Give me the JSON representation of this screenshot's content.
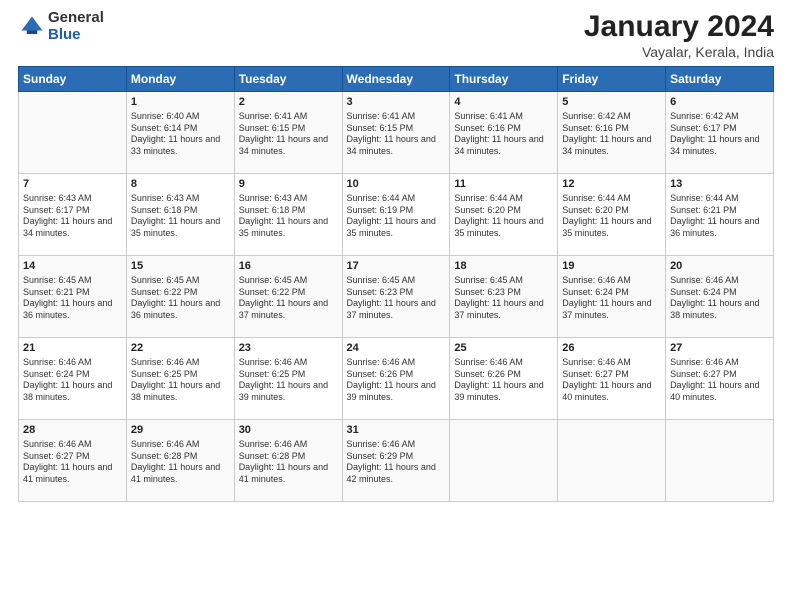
{
  "logo": {
    "general": "General",
    "blue": "Blue"
  },
  "header": {
    "title": "January 2024",
    "subtitle": "Vayalar, Kerala, India"
  },
  "columns": [
    "Sunday",
    "Monday",
    "Tuesday",
    "Wednesday",
    "Thursday",
    "Friday",
    "Saturday"
  ],
  "weeks": [
    [
      {
        "day": "",
        "sunrise": "",
        "sunset": "",
        "daylight": ""
      },
      {
        "day": "1",
        "sunrise": "Sunrise: 6:40 AM",
        "sunset": "Sunset: 6:14 PM",
        "daylight": "Daylight: 11 hours and 33 minutes."
      },
      {
        "day": "2",
        "sunrise": "Sunrise: 6:41 AM",
        "sunset": "Sunset: 6:15 PM",
        "daylight": "Daylight: 11 hours and 34 minutes."
      },
      {
        "day": "3",
        "sunrise": "Sunrise: 6:41 AM",
        "sunset": "Sunset: 6:15 PM",
        "daylight": "Daylight: 11 hours and 34 minutes."
      },
      {
        "day": "4",
        "sunrise": "Sunrise: 6:41 AM",
        "sunset": "Sunset: 6:16 PM",
        "daylight": "Daylight: 11 hours and 34 minutes."
      },
      {
        "day": "5",
        "sunrise": "Sunrise: 6:42 AM",
        "sunset": "Sunset: 6:16 PM",
        "daylight": "Daylight: 11 hours and 34 minutes."
      },
      {
        "day": "6",
        "sunrise": "Sunrise: 6:42 AM",
        "sunset": "Sunset: 6:17 PM",
        "daylight": "Daylight: 11 hours and 34 minutes."
      }
    ],
    [
      {
        "day": "7",
        "sunrise": "Sunrise: 6:43 AM",
        "sunset": "Sunset: 6:17 PM",
        "daylight": "Daylight: 11 hours and 34 minutes."
      },
      {
        "day": "8",
        "sunrise": "Sunrise: 6:43 AM",
        "sunset": "Sunset: 6:18 PM",
        "daylight": "Daylight: 11 hours and 35 minutes."
      },
      {
        "day": "9",
        "sunrise": "Sunrise: 6:43 AM",
        "sunset": "Sunset: 6:18 PM",
        "daylight": "Daylight: 11 hours and 35 minutes."
      },
      {
        "day": "10",
        "sunrise": "Sunrise: 6:44 AM",
        "sunset": "Sunset: 6:19 PM",
        "daylight": "Daylight: 11 hours and 35 minutes."
      },
      {
        "day": "11",
        "sunrise": "Sunrise: 6:44 AM",
        "sunset": "Sunset: 6:20 PM",
        "daylight": "Daylight: 11 hours and 35 minutes."
      },
      {
        "day": "12",
        "sunrise": "Sunrise: 6:44 AM",
        "sunset": "Sunset: 6:20 PM",
        "daylight": "Daylight: 11 hours and 35 minutes."
      },
      {
        "day": "13",
        "sunrise": "Sunrise: 6:44 AM",
        "sunset": "Sunset: 6:21 PM",
        "daylight": "Daylight: 11 hours and 36 minutes."
      }
    ],
    [
      {
        "day": "14",
        "sunrise": "Sunrise: 6:45 AM",
        "sunset": "Sunset: 6:21 PM",
        "daylight": "Daylight: 11 hours and 36 minutes."
      },
      {
        "day": "15",
        "sunrise": "Sunrise: 6:45 AM",
        "sunset": "Sunset: 6:22 PM",
        "daylight": "Daylight: 11 hours and 36 minutes."
      },
      {
        "day": "16",
        "sunrise": "Sunrise: 6:45 AM",
        "sunset": "Sunset: 6:22 PM",
        "daylight": "Daylight: 11 hours and 37 minutes."
      },
      {
        "day": "17",
        "sunrise": "Sunrise: 6:45 AM",
        "sunset": "Sunset: 6:23 PM",
        "daylight": "Daylight: 11 hours and 37 minutes."
      },
      {
        "day": "18",
        "sunrise": "Sunrise: 6:45 AM",
        "sunset": "Sunset: 6:23 PM",
        "daylight": "Daylight: 11 hours and 37 minutes."
      },
      {
        "day": "19",
        "sunrise": "Sunrise: 6:46 AM",
        "sunset": "Sunset: 6:24 PM",
        "daylight": "Daylight: 11 hours and 37 minutes."
      },
      {
        "day": "20",
        "sunrise": "Sunrise: 6:46 AM",
        "sunset": "Sunset: 6:24 PM",
        "daylight": "Daylight: 11 hours and 38 minutes."
      }
    ],
    [
      {
        "day": "21",
        "sunrise": "Sunrise: 6:46 AM",
        "sunset": "Sunset: 6:24 PM",
        "daylight": "Daylight: 11 hours and 38 minutes."
      },
      {
        "day": "22",
        "sunrise": "Sunrise: 6:46 AM",
        "sunset": "Sunset: 6:25 PM",
        "daylight": "Daylight: 11 hours and 38 minutes."
      },
      {
        "day": "23",
        "sunrise": "Sunrise: 6:46 AM",
        "sunset": "Sunset: 6:25 PM",
        "daylight": "Daylight: 11 hours and 39 minutes."
      },
      {
        "day": "24",
        "sunrise": "Sunrise: 6:46 AM",
        "sunset": "Sunset: 6:26 PM",
        "daylight": "Daylight: 11 hours and 39 minutes."
      },
      {
        "day": "25",
        "sunrise": "Sunrise: 6:46 AM",
        "sunset": "Sunset: 6:26 PM",
        "daylight": "Daylight: 11 hours and 39 minutes."
      },
      {
        "day": "26",
        "sunrise": "Sunrise: 6:46 AM",
        "sunset": "Sunset: 6:27 PM",
        "daylight": "Daylight: 11 hours and 40 minutes."
      },
      {
        "day": "27",
        "sunrise": "Sunrise: 6:46 AM",
        "sunset": "Sunset: 6:27 PM",
        "daylight": "Daylight: 11 hours and 40 minutes."
      }
    ],
    [
      {
        "day": "28",
        "sunrise": "Sunrise: 6:46 AM",
        "sunset": "Sunset: 6:27 PM",
        "daylight": "Daylight: 11 hours and 41 minutes."
      },
      {
        "day": "29",
        "sunrise": "Sunrise: 6:46 AM",
        "sunset": "Sunset: 6:28 PM",
        "daylight": "Daylight: 11 hours and 41 minutes."
      },
      {
        "day": "30",
        "sunrise": "Sunrise: 6:46 AM",
        "sunset": "Sunset: 6:28 PM",
        "daylight": "Daylight: 11 hours and 41 minutes."
      },
      {
        "day": "31",
        "sunrise": "Sunrise: 6:46 AM",
        "sunset": "Sunset: 6:29 PM",
        "daylight": "Daylight: 11 hours and 42 minutes."
      },
      {
        "day": "",
        "sunrise": "",
        "sunset": "",
        "daylight": ""
      },
      {
        "day": "",
        "sunrise": "",
        "sunset": "",
        "daylight": ""
      },
      {
        "day": "",
        "sunrise": "",
        "sunset": "",
        "daylight": ""
      }
    ]
  ]
}
